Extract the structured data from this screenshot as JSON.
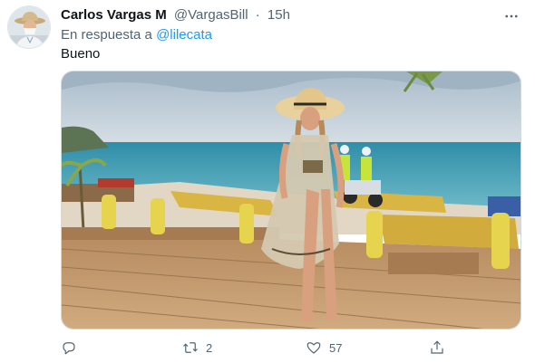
{
  "tweet": {
    "author_name": "Carlos Vargas M",
    "author_handle": "@VargasBill",
    "separator": "·",
    "time": "15h",
    "reply_prefix": "En respuesta a",
    "reply_mention": "@lilecata",
    "text": "Bueno",
    "reply_count": "",
    "retweet_count": "2",
    "like_count": "57"
  },
  "colors": {
    "accent": "#1d9bf0",
    "secondary_text": "#536471",
    "primary_text": "#0f1419"
  },
  "icons": {
    "more": "more-dots-icon",
    "reply": "reply-icon",
    "retweet": "retweet-icon",
    "like": "like-icon",
    "share": "share-icon"
  }
}
